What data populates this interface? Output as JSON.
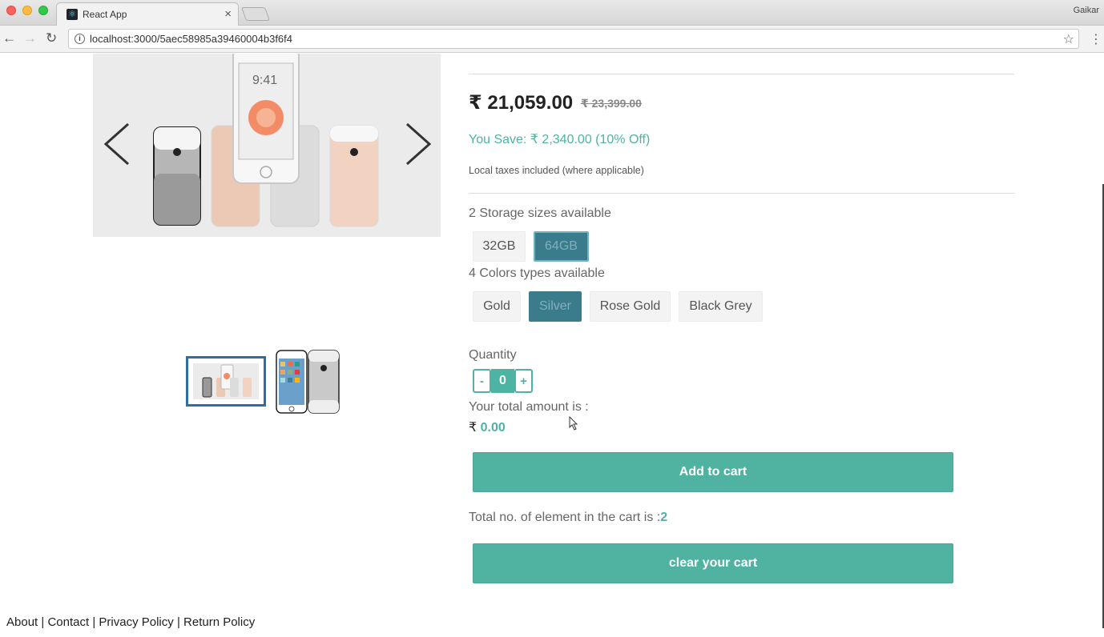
{
  "browser": {
    "tab_title": "React App",
    "profile_name": "Gaikar",
    "url": "localhost:3000/5aec58985a39460004b3f6f4"
  },
  "product": {
    "price": "₹ 21,059.00",
    "old_price": "₹ 23,399.00",
    "save_text": "You Save: ₹ 2,340.00  (10% Off)",
    "tax_note": "Local taxes included (where applicable)",
    "screen_time": "9:41"
  },
  "storage": {
    "label": "2 Storage sizes available",
    "options": [
      "32GB",
      "64GB"
    ],
    "selected": "64GB"
  },
  "colors": {
    "label": "4 Colors types available",
    "options": [
      "Gold",
      "Silver",
      "Rose Gold",
      "Black Grey"
    ],
    "selected": "Silver"
  },
  "quantity": {
    "label": "Quantity",
    "minus": "-",
    "value": "0",
    "plus": "+"
  },
  "total": {
    "label": "Your total amount is :",
    "currency": "₹",
    "value": "0.00"
  },
  "cart": {
    "add_label": "Add to cart",
    "count_label": "Total no. of element in the cart is :",
    "count": "2",
    "clear_label": "clear your cart"
  },
  "footer": {
    "links": [
      "About",
      "Contact",
      "Privacy Policy",
      "Return Policy"
    ],
    "separator": "|"
  },
  "colors_theme": {
    "accent": "#50b3a2",
    "selected": "#3b7c8c",
    "thumb_border": "#2f6da6"
  }
}
